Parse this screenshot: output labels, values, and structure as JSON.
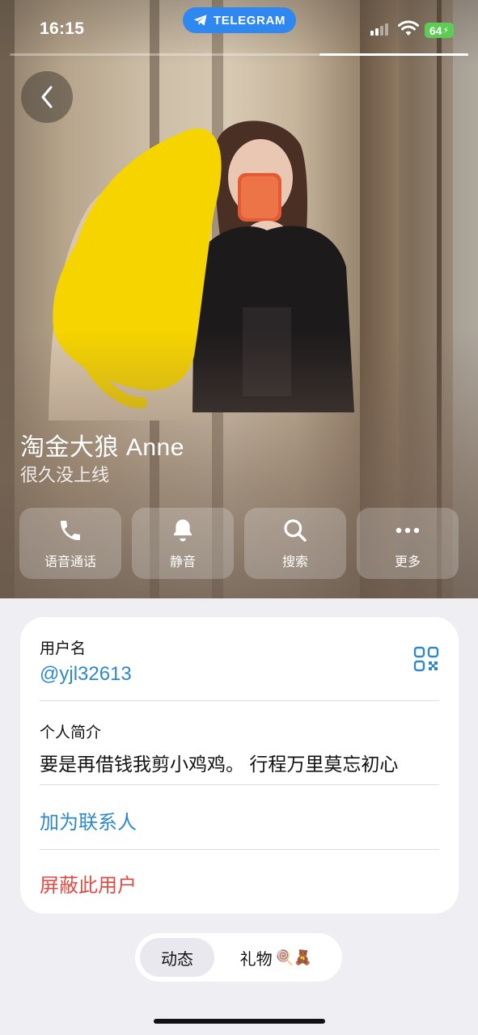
{
  "status_bar": {
    "time": "16:15",
    "app_pill": "TELEGRAM",
    "battery": "64"
  },
  "profile": {
    "name": "淘金大狼 Anne",
    "last_seen": "很久没上线"
  },
  "actions": [
    {
      "label": "语音通话",
      "icon": "phone-icon"
    },
    {
      "label": "静音",
      "icon": "bell-icon"
    },
    {
      "label": "搜索",
      "icon": "search-icon"
    },
    {
      "label": "更多",
      "icon": "more-icon"
    }
  ],
  "info": {
    "username_label": "用户名",
    "username_value": "@yjl32613",
    "bio_label": "个人简介",
    "bio_value": "要是再借钱我剪小鸡鸡。 行程万里莫忘初心",
    "add_contact": "加为联系人",
    "block_user": "屏蔽此用户"
  },
  "tabs": {
    "posts": "动态",
    "gifts": "礼物",
    "gift_emojis": "🍭🧸"
  },
  "colors": {
    "link_blue": "#2f89c9",
    "danger_red": "#e04b43",
    "telegram_blue": "#2f87f0",
    "battery_green": "#5ecb55",
    "redaction_yellow": "#f6d400"
  }
}
